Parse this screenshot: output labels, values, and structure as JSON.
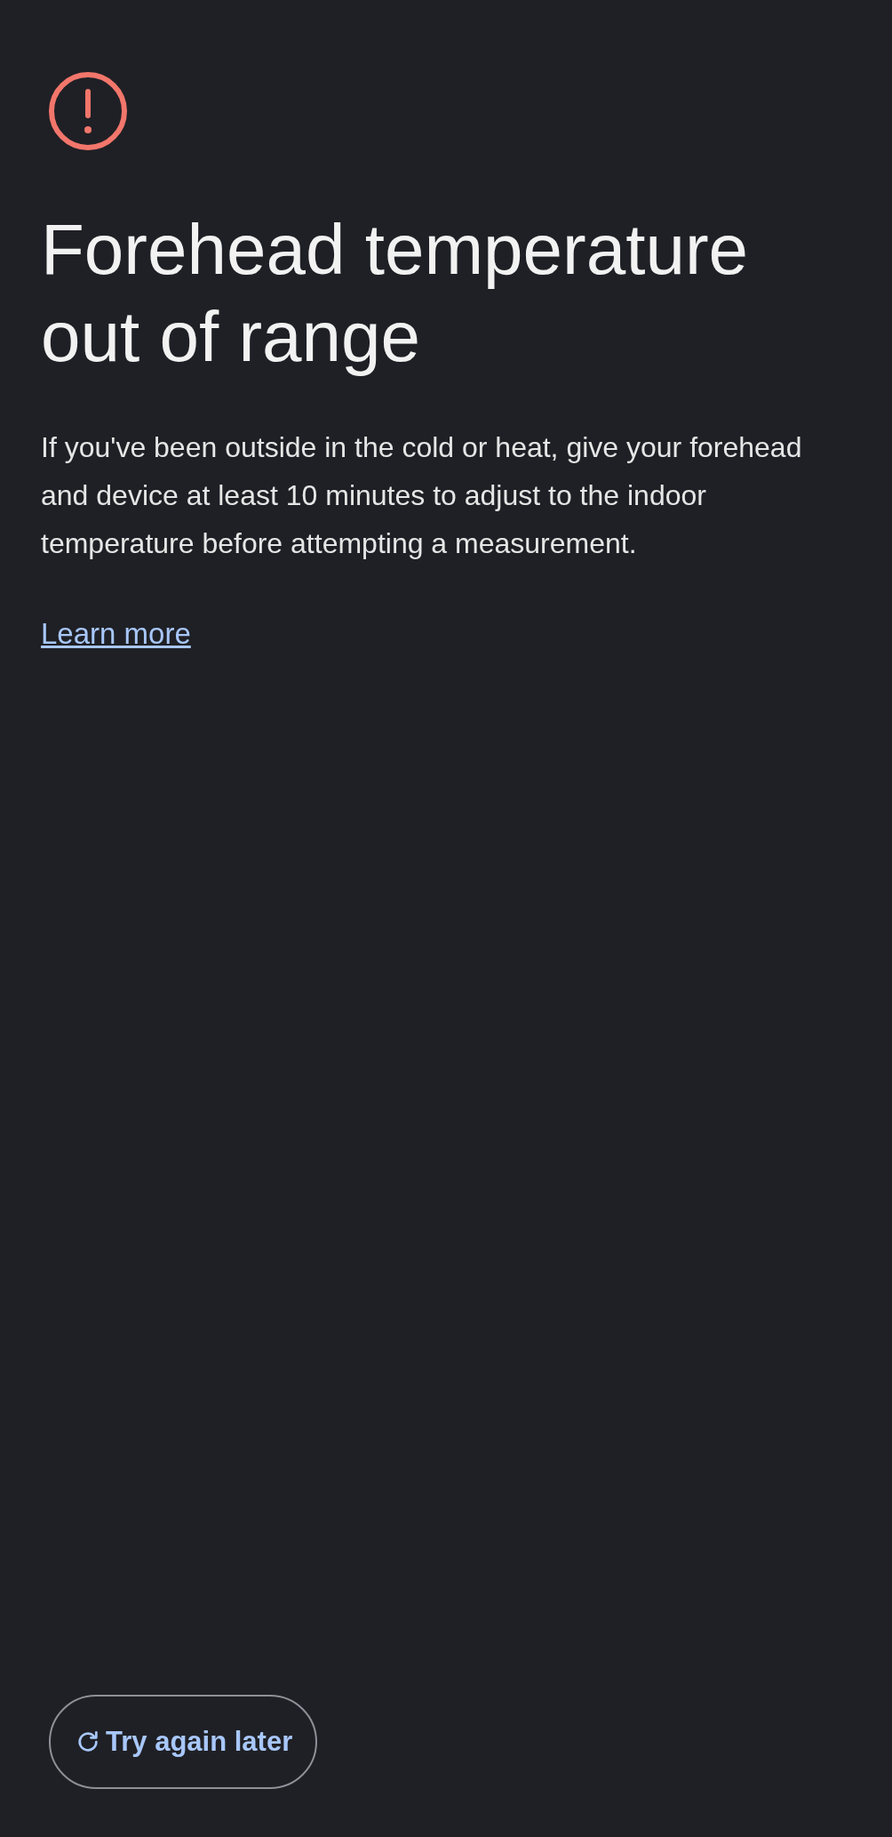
{
  "title": "Forehead temperature out of range",
  "message": "If you've been outside in the cold or heat, give your forehead and device at least 10 minutes to adjust to the indoor temperature before attempting a measurement.",
  "link": "Learn more",
  "button": {
    "label": "Try again later"
  }
}
